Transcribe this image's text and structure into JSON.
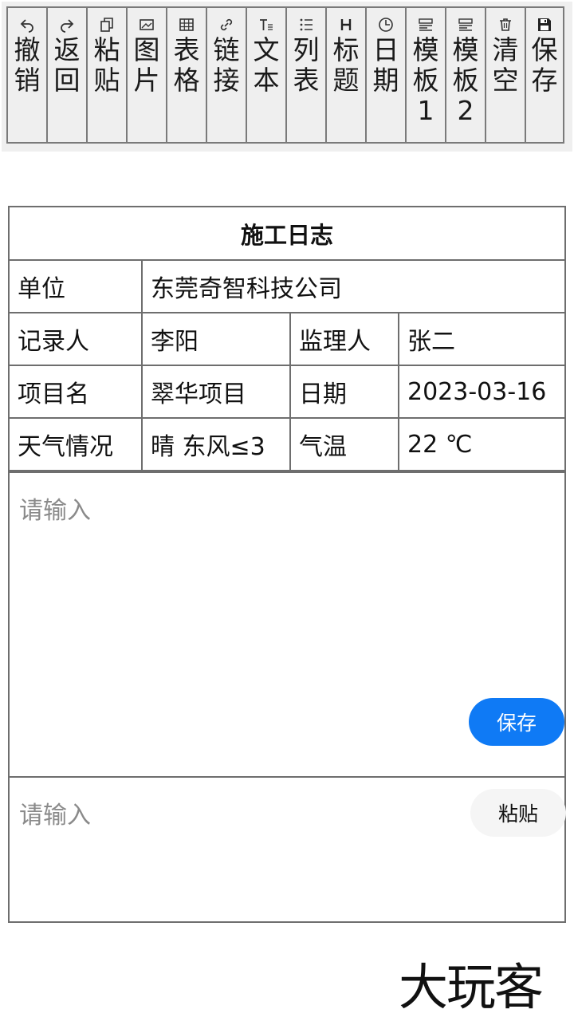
{
  "toolbar": {
    "buttons": [
      {
        "label": "撤销",
        "icon": "undo-icon"
      },
      {
        "label": "返回",
        "icon": "redo-icon"
      },
      {
        "label": "粘贴",
        "icon": "paste-icon"
      },
      {
        "label": "图片",
        "icon": "image-icon"
      },
      {
        "label": "表格",
        "icon": "table-icon"
      },
      {
        "label": "链接",
        "icon": "link-icon"
      },
      {
        "label": "文本",
        "icon": "text-icon"
      },
      {
        "label": "列表",
        "icon": "list-icon"
      },
      {
        "label": "标题",
        "icon": "heading-icon"
      },
      {
        "label": "日期",
        "icon": "clock-icon"
      },
      {
        "label": "模板1",
        "icon": "template-icon"
      },
      {
        "label": "模板2",
        "icon": "template-icon"
      },
      {
        "label": "清空",
        "icon": "trash-icon"
      },
      {
        "label": "保存",
        "icon": "floppy-icon"
      }
    ]
  },
  "log": {
    "title": "施工日志",
    "unit_label": "单位",
    "unit_value": "东莞奇智科技公司",
    "recorder_label": "记录人",
    "recorder_value": "李阳",
    "supervisor_label": "监理人",
    "supervisor_value": "张二",
    "project_label": "项目名",
    "project_value": "翠华项目",
    "date_label": "日期",
    "date_value": "2023-03-16",
    "weather_label": "天气情况",
    "weather_value": "晴 东风≤3",
    "temp_label": "气温",
    "temp_value": "22 ℃"
  },
  "editor": {
    "placeholder": "请输入",
    "save_label": "保存"
  },
  "input2": {
    "placeholder": "请输入",
    "paste_label": "粘贴"
  },
  "watermark": "大玩客",
  "colors": {
    "accent": "#0f7af5",
    "border": "#6e6e6e",
    "toolbar_bg": "#efefef"
  }
}
